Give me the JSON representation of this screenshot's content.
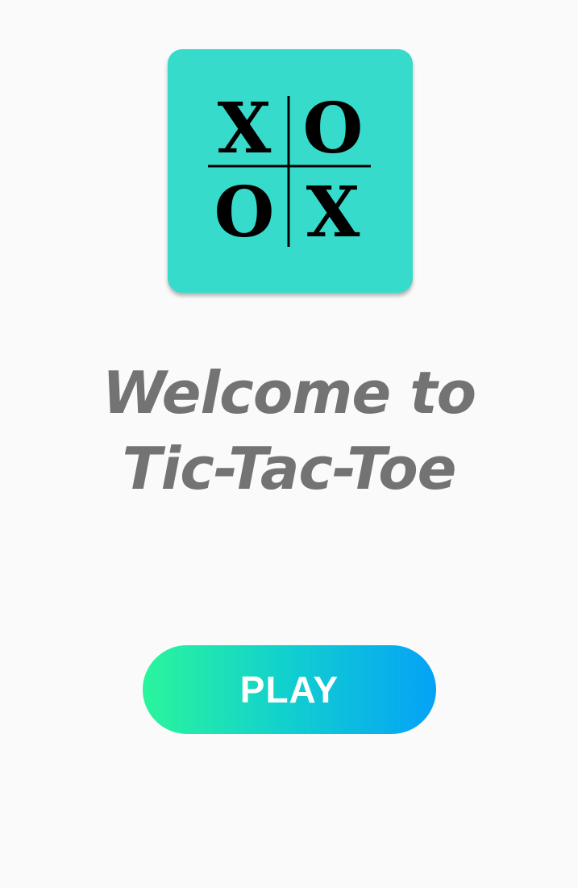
{
  "app_logo": {
    "icon": "tic-tac-toe-logo",
    "background_color": "#37dbcb",
    "cells": [
      "X",
      "O",
      "O",
      "X"
    ]
  },
  "welcome": {
    "line1": "Welcome to",
    "line2": "Tic-Tac-Toe"
  },
  "play_button": {
    "label": "PLAY",
    "gradient_colors": [
      "#2af59c",
      "#05a2f7"
    ]
  }
}
